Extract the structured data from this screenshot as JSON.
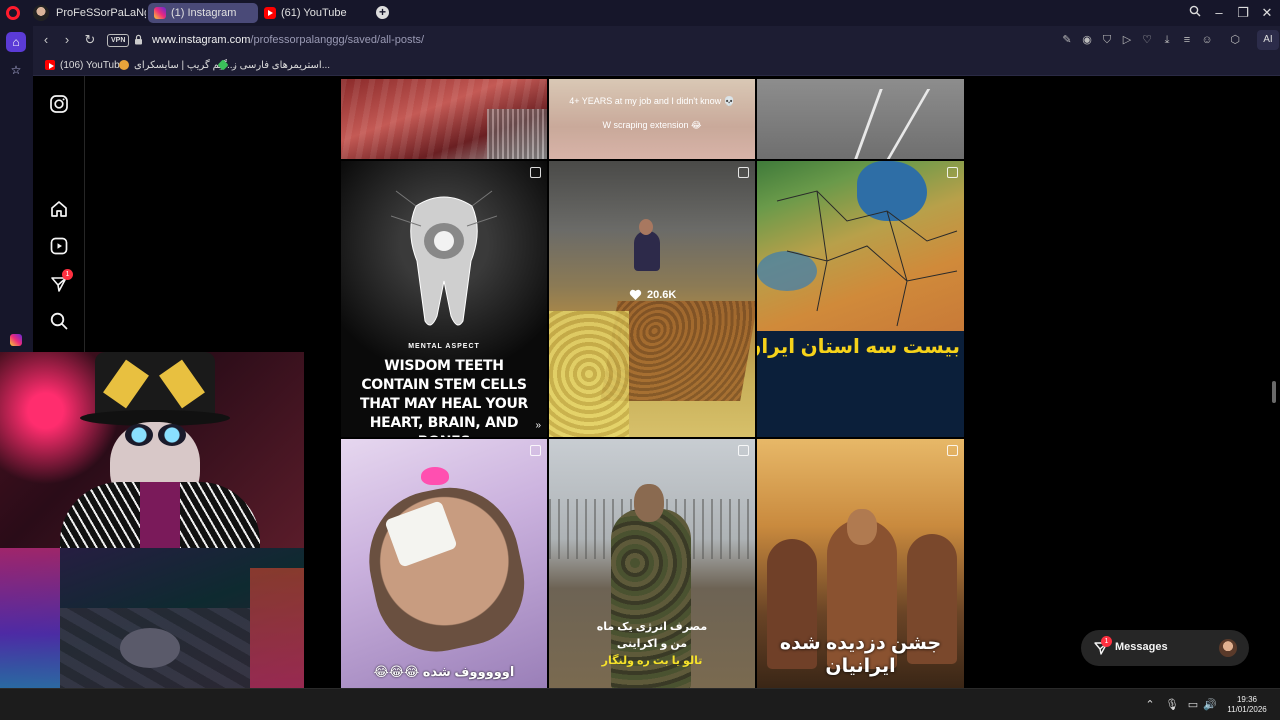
{
  "browser": {
    "tabs": [
      {
        "label": "ProFeSSorPaLaNg Stream",
        "active": false
      },
      {
        "label": "(1) Instagram",
        "active": true
      },
      {
        "label": "(61) YouTube",
        "active": false
      }
    ],
    "url_domain": "www.instagram.com",
    "url_path": "/professorpalanggg/saved/all-posts/",
    "vpn_label": "VPN",
    "ai_label": "AI",
    "bookmarks": [
      {
        "label": "(106) YouTube",
        "icon": "youtube-icon"
      },
      {
        "label": "گیم گریپ | سایسکرای...",
        "icon": "site-icon"
      },
      {
        "label": "استریمرهای فارسی ز...",
        "icon": "site-icon"
      }
    ]
  },
  "instagram": {
    "nav": [
      {
        "icon": "instagram-logo-icon"
      },
      {
        "icon": "home-icon"
      },
      {
        "icon": "reels-icon"
      },
      {
        "icon": "messages-icon",
        "badge": "1"
      },
      {
        "icon": "search-icon"
      }
    ],
    "posts": {
      "row0_mid_caption1": "4+ YEARS at my job and I didn't know 💀",
      "row0_mid_caption2": "W scraping extension 😂",
      "teeth_brand": "MENTAL ASPECT",
      "teeth_text": "WISDOM TEETH CONTAIN STEM CELLS THAT MAY HEAL YOUR HEART, BRAIN, AND BONES",
      "food_likes": "20.6K",
      "map_caption": "بیست سه استان ایران با در سنگ نوشته داریوش بر هخامنشی در بیستون کرمانشاه",
      "hospital_caption": "اوووووف شده 😂😂😂",
      "soldier_caption1": "مصرف انرژی یک ماه",
      "soldier_caption2": "من و اکراینی",
      "soldier_caption3": "تالو یا بت ره ولنگار",
      "festival_caption": "جشن دزدیده شده ایرانیان"
    },
    "messages": {
      "label": "Messages",
      "badge": "1"
    }
  },
  "taskbar": {
    "time": "19:36",
    "date": "11/01/2026"
  },
  "colors": {
    "opera_red": "#ff1b2d",
    "tab_active": "#4a4a78",
    "sidebar_accent": "#5b3bd6",
    "ig_badge": "#ff3040"
  }
}
